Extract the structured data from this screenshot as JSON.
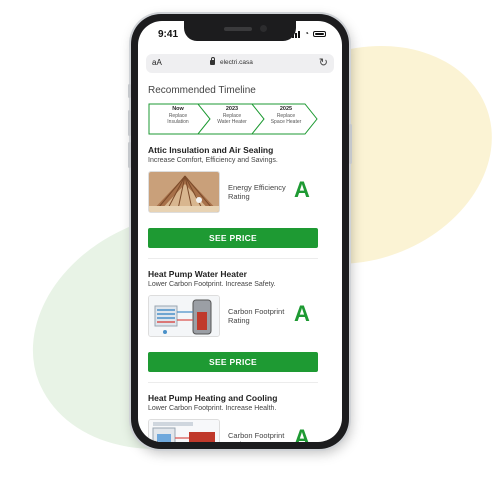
{
  "status_bar": {
    "time": "9:41"
  },
  "browser": {
    "text_size_label": "aA",
    "url": "electri.casa"
  },
  "timeline": {
    "title": "Recommended Timeline",
    "steps": [
      {
        "when": "Now",
        "what": "Replace\nInsulation"
      },
      {
        "when": "2023",
        "what": "Replace\nWater Heater"
      },
      {
        "when": "2025",
        "what": "Replace\nSpace Heater"
      }
    ]
  },
  "cards": [
    {
      "title": "Attic Insulation and Air Sealing",
      "subtitle": "Increase Comfort, Efficiency and Savings.",
      "rating_label": "Energy Efficiency Rating",
      "rating": "A",
      "button_label": "SEE PRICE"
    },
    {
      "title": "Heat Pump Water Heater",
      "subtitle": "Lower Carbon Footprint. Increase Safety.",
      "rating_label": "Carbon Footprint Rating",
      "rating": "A",
      "button_label": "SEE PRICE"
    },
    {
      "title": "Heat Pump Heating and Cooling",
      "subtitle": "Lower Carbon Footprint. Increase Health.",
      "rating_label": "Carbon Footprint Rating",
      "rating": "A"
    }
  ],
  "colors": {
    "accent": "#1e9a33",
    "blob_yellow": "#fbf3d4",
    "blob_green": "#e8f3e6"
  }
}
